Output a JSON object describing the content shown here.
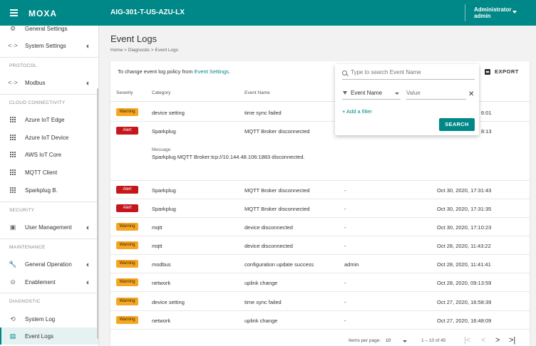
{
  "header": {
    "logo": "MOXA",
    "device": "AIG-301-T-US-AZU-LX",
    "user_role": "Administrator",
    "user_name": "admin"
  },
  "sidebar": {
    "items": [
      {
        "label": "General Settings",
        "icon": "gear-icon"
      },
      {
        "label": "System Settings",
        "icon": "code-icon"
      },
      {
        "label": "Modbus",
        "icon": "code-icon"
      },
      {
        "label": "Azure IoT Edge",
        "icon": "grid-icon"
      },
      {
        "label": "Azure IoT Device",
        "icon": "grid-icon"
      },
      {
        "label": "AWS IoT Core",
        "icon": "grid-icon"
      },
      {
        "label": "MQTT Client",
        "icon": "grid-icon"
      },
      {
        "label": "Sparkplug B.",
        "icon": "grid-icon"
      },
      {
        "label": "User Management",
        "icon": "id-card-icon"
      },
      {
        "label": "General Operation",
        "icon": "wrench-icon"
      },
      {
        "label": "Enablement",
        "icon": "toggle-icon"
      },
      {
        "label": "System Log",
        "icon": "history-icon"
      },
      {
        "label": "Event Logs",
        "icon": "calendar-icon"
      }
    ],
    "sections": {
      "protocol": "PROTOCOL",
      "cloud": "CLOUD CONNECTIVITY",
      "security": "SECURITY",
      "maintenance": "MAINTENANCE",
      "diagnostic": "DIAGNOSTIC"
    }
  },
  "page": {
    "title": "Event Logs",
    "breadcrumb": "Home > Diagnostic > Event Logs",
    "policy_text": "To change event log policy from ",
    "policy_link": "Event Settings",
    "policy_end": ".",
    "export_label": "EXPORT"
  },
  "table": {
    "headers": {
      "severity": "Severity",
      "category": "Category",
      "event": "Event Name"
    },
    "rows": [
      {
        "severity": "Warning",
        "category": "device setting",
        "event": "time sync failed",
        "user": "",
        "time": "6:01"
      },
      {
        "severity": "Alert",
        "category": "Sparkplug",
        "event": "MQTT Broker disconnected",
        "user": "",
        "time": "8:13"
      },
      {
        "severity": "Alert",
        "category": "Sparkplug",
        "event": "MQTT Broker disconnected",
        "user": "-",
        "time": "Oct 30, 2020, 17:31:43"
      },
      {
        "severity": "Alert",
        "category": "Sparkplug",
        "event": "MQTT Broker disconnected",
        "user": "-",
        "time": "Oct 30, 2020, 17:31:35"
      },
      {
        "severity": "Warning",
        "category": "mqtt",
        "event": "device disconnected",
        "user": "-",
        "time": "Oct 30, 2020, 17:10:23"
      },
      {
        "severity": "Warning",
        "category": "mqtt",
        "event": "device disconnected",
        "user": "-",
        "time": "Oct 28, 2020, 11:43:22"
      },
      {
        "severity": "Warning",
        "category": "modbus",
        "event": "configuration update success",
        "user": "admin",
        "time": "Oct 28, 2020, 11:41:41"
      },
      {
        "severity": "Warning",
        "category": "network",
        "event": "uplink change",
        "user": "-",
        "time": "Oct 28, 2020, 09:13:59"
      },
      {
        "severity": "Warning",
        "category": "device setting",
        "event": "time sync failed",
        "user": "-",
        "time": "Oct 27, 2020, 16:58:39"
      },
      {
        "severity": "Warning",
        "category": "network",
        "event": "uplink change",
        "user": "-",
        "time": "Oct 27, 2020, 16:48:09"
      }
    ],
    "expanded": {
      "label": "Message",
      "text": "Sparkplug MQTT Broker:tcp://10.144.48.106:1883 disconnected."
    }
  },
  "footer": {
    "items_per_page_label": "Items per page:",
    "items_per_page": "10",
    "range": "1 – 10 of 45"
  },
  "filter": {
    "search_placeholder": "Type to search Event Name",
    "field": "Event Name",
    "value_placeholder": "Value",
    "add_filter": "+ Add a filter",
    "search_button": "SEARCH"
  },
  "colors": {
    "brand": "#008787",
    "warning": "#f5a623",
    "alert": "#c4161c"
  }
}
